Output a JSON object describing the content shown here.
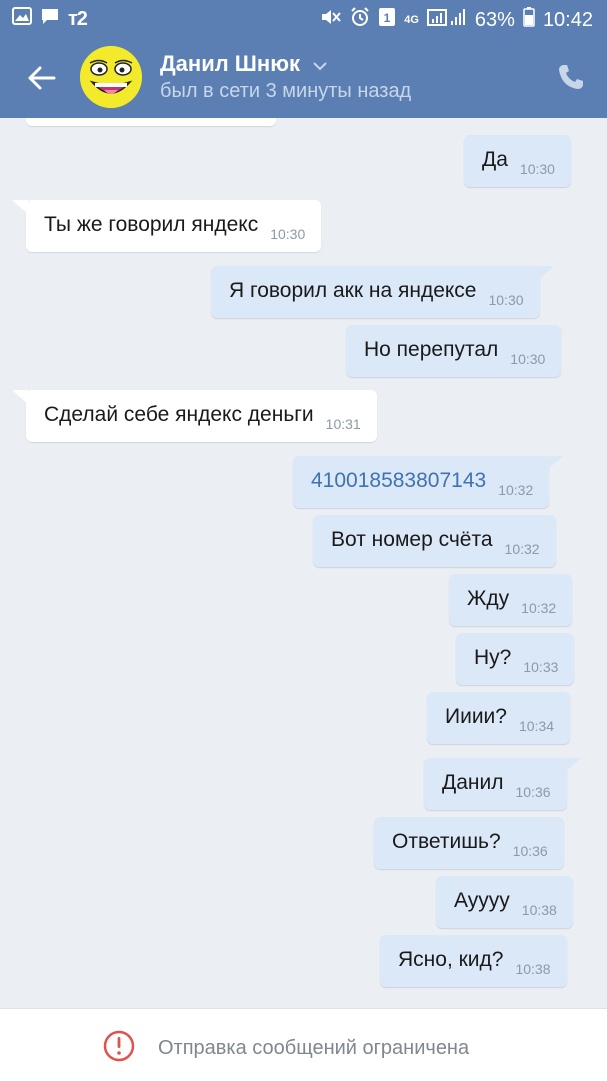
{
  "status_bar": {
    "carrier": "т2",
    "network": "4G",
    "battery": "63%",
    "time": "10:42",
    "sim_slot": "1"
  },
  "header": {
    "contact_name": "Данил Шнюк",
    "contact_status": "был в сети 3 минуты назад"
  },
  "messages": [
    {
      "direction": "out",
      "text": "Да",
      "time": "10:30"
    },
    {
      "direction": "in",
      "text": "Ты же говорил яндекс",
      "time": "10:30"
    },
    {
      "direction": "out",
      "text": "Я говорил акк на яндексе",
      "time": "10:30"
    },
    {
      "direction": "out",
      "text": "Но перепутал",
      "time": "10:30"
    },
    {
      "direction": "in",
      "text": "Сделай себе яндекс деньги",
      "time": "10:31"
    },
    {
      "direction": "out",
      "text": "410018583807143",
      "time": "10:32",
      "link": true
    },
    {
      "direction": "out",
      "text": "Вот номер счёта",
      "time": "10:32"
    },
    {
      "direction": "out",
      "text": "Жду",
      "time": "10:32"
    },
    {
      "direction": "out",
      "text": "Ну?",
      "time": "10:33"
    },
    {
      "direction": "out",
      "text": "Ииии?",
      "time": "10:34"
    },
    {
      "direction": "out",
      "text": "Данил",
      "time": "10:36"
    },
    {
      "direction": "out",
      "text": "Ответишь?",
      "time": "10:36"
    },
    {
      "direction": "out",
      "text": "Ауууу",
      "time": "10:38"
    },
    {
      "direction": "out",
      "text": "Ясно, кид?",
      "time": "10:38"
    }
  ],
  "footer": {
    "restriction_text": "Отправка сообщений ограничена"
  },
  "colors": {
    "header": "#5b7fb3",
    "background": "#ebeff4",
    "outgoing_bubble": "#dbe8f8",
    "incoming_bubble": "#ffffff",
    "link": "#3f72b0",
    "warning_red": "#e0524a"
  },
  "icons": {
    "back": "arrow-left-icon",
    "phone": "phone-icon",
    "footer": "alert-circle-icon"
  }
}
